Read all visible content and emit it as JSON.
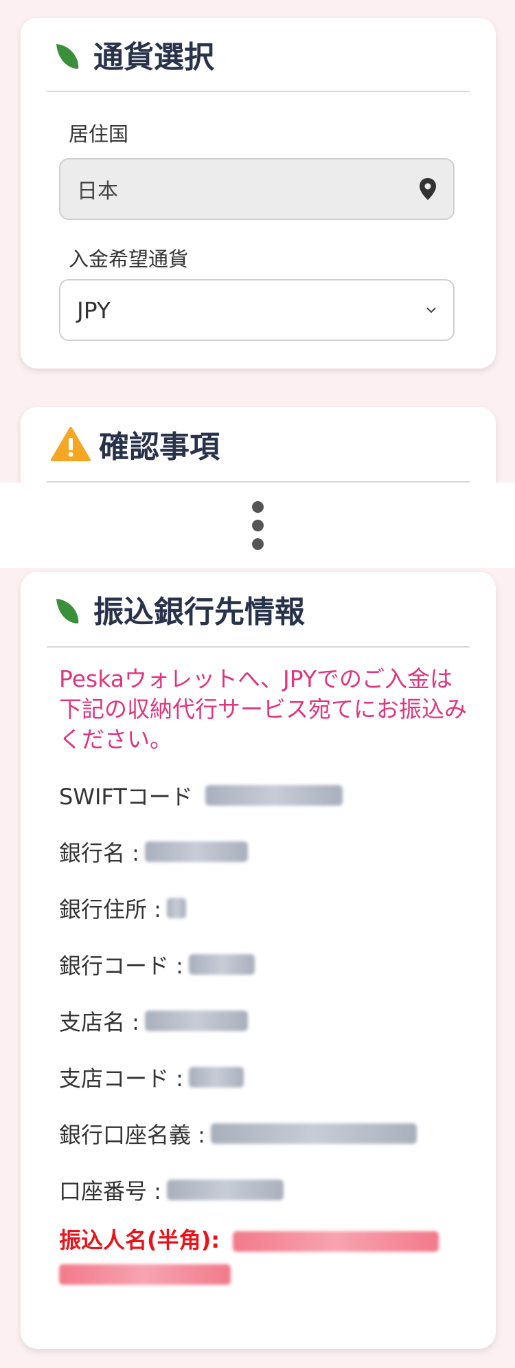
{
  "currency_section": {
    "title": "通貨選択",
    "residence_label": "居住国",
    "residence_value": "日本",
    "currency_label": "入金希望通貨",
    "currency_value": "JPY"
  },
  "confirm_section": {
    "title": "確認事項"
  },
  "bank_section": {
    "title": "振込銀行先情報",
    "intro": "Peskaウォレットへ、JPYでのご入金は下記の収納代行サービス宛てにお振込みください。",
    "fields": [
      {
        "label": "SWIFTコード"
      },
      {
        "label": "銀行名 :"
      },
      {
        "label": "銀行住所 :"
      },
      {
        "label": "銀行コード :"
      },
      {
        "label": "支店名 :"
      },
      {
        "label": "支店コード :"
      },
      {
        "label": "銀行口座名義 :"
      },
      {
        "label": "口座番号 :"
      }
    ],
    "payer_label": "振込人名(半角):"
  },
  "colors": {
    "accent_green": "#3a8f3a",
    "warning_orange": "#f5a623",
    "intro_pink": "#e0357e",
    "payer_red": "#e8141c",
    "title_navy": "#28324a"
  },
  "icons": {
    "section_leaf": "leaf-icon",
    "warning": "warning-icon",
    "location": "location-pin-icon",
    "dropdown": "chevron-down-icon"
  }
}
